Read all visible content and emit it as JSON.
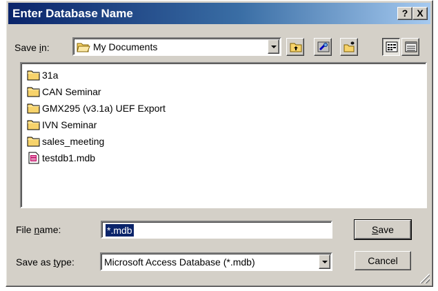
{
  "dialog": {
    "title": "Enter Database Name",
    "help_label": "?",
    "close_label": "X"
  },
  "save_in": {
    "label_pre": "Save ",
    "label_accel": "i",
    "label_post": "n:",
    "value": "My Documents"
  },
  "toolbar": {
    "buttons": [
      "up-one-level",
      "search-web",
      "create-new-folder",
      "list-view",
      "details-view"
    ]
  },
  "files": [
    {
      "name": "31a",
      "type": "folder"
    },
    {
      "name": "CAN Seminar",
      "type": "folder"
    },
    {
      "name": "GMX295 (v3.1a) UEF Export",
      "type": "folder"
    },
    {
      "name": "IVN Seminar",
      "type": "folder"
    },
    {
      "name": "sales_meeting",
      "type": "folder"
    },
    {
      "name": "testdb1.mdb",
      "type": "database"
    }
  ],
  "file_name": {
    "label_pre": "File ",
    "label_accel": "n",
    "label_post": "ame:",
    "value": "*.mdb"
  },
  "save_as_type": {
    "label_pre": "Save as ",
    "label_accel": "t",
    "label_post": "ype:",
    "value": "Microsoft Access Database (*.mdb)"
  },
  "buttons": {
    "save_accel": "S",
    "save_rest": "ave",
    "cancel": "Cancel"
  },
  "colors": {
    "title_gradient_start": "#0a246a",
    "title_gradient_end": "#a6caf0",
    "face": "#d4d0c8",
    "selection": "#0a246a",
    "folder": "#f7d36b"
  }
}
